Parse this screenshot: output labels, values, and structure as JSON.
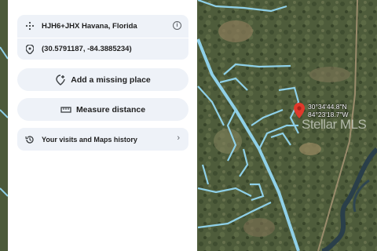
{
  "place": {
    "plus_code": "HJH6+JHX Havana, Florida",
    "coordinates": "(30.5791187, -84.3885234)"
  },
  "actions": {
    "add_place": "Add a missing place",
    "measure": "Measure distance",
    "history": "Your visits and Maps history"
  },
  "map": {
    "pin_lat": "30°34'44.8\"N",
    "pin_lng": "84°23'18.7\"W",
    "watermark": "Stellar MLS"
  },
  "colors": {
    "road": "#8fd0e8",
    "pin": "#e0392b",
    "panel_card": "#eef2f8"
  },
  "icons": [
    "plus-code-icon",
    "pin-icon",
    "info-icon",
    "add-place-icon",
    "ruler-icon",
    "history-icon",
    "chevron-right-icon"
  ]
}
